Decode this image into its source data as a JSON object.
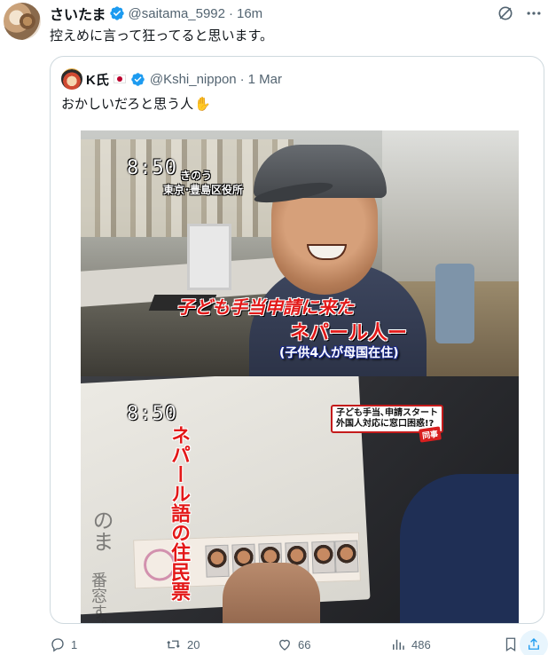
{
  "post": {
    "display_name": "さいたま",
    "handle": "@saitama_5992",
    "separator": "·",
    "time": "16m",
    "text": "控えめに言って狂ってると思います。"
  },
  "quoted_post": {
    "display_name": "K氏",
    "handle": "@Kshi_nippon",
    "separator": "·",
    "time": "1 Mar",
    "text": "おかしいだろと思う人",
    "emoji": "✋",
    "media": {
      "top_panel": {
        "time": "8:50",
        "day": "きのう",
        "location": "東京･豊島区役所",
        "caption_red": "子ども手当申請に来た",
        "caption_main": "ネパール人ー",
        "caption_sub": "(子供4人が母国在住)"
      },
      "bottom_panel": {
        "time": "8:50",
        "headline_line1": "子ども手当､申請スタート",
        "headline_line2": "外国人対応に窓口困惑!?",
        "headline_tag": "同事",
        "vertical_caption": "ネパール語の住民票",
        "paper_text_1": "のま",
        "paper_text_2": "番窓す。"
      }
    }
  },
  "actions": {
    "replies": "1",
    "reposts": "20",
    "likes": "66",
    "views": "486"
  },
  "colors": {
    "verified_blue": "#1d9bf0",
    "muted_text": "#536471",
    "border": "#cfd9de",
    "osd_red": "#e21919"
  },
  "icons": {
    "verified": "verified-badge-icon",
    "grok": "grok-icon",
    "more": "more-icon",
    "reply": "reply-icon",
    "repost": "repost-icon",
    "like": "like-icon",
    "views": "views-icon",
    "bookmark": "bookmark-icon",
    "share": "share-icon"
  }
}
